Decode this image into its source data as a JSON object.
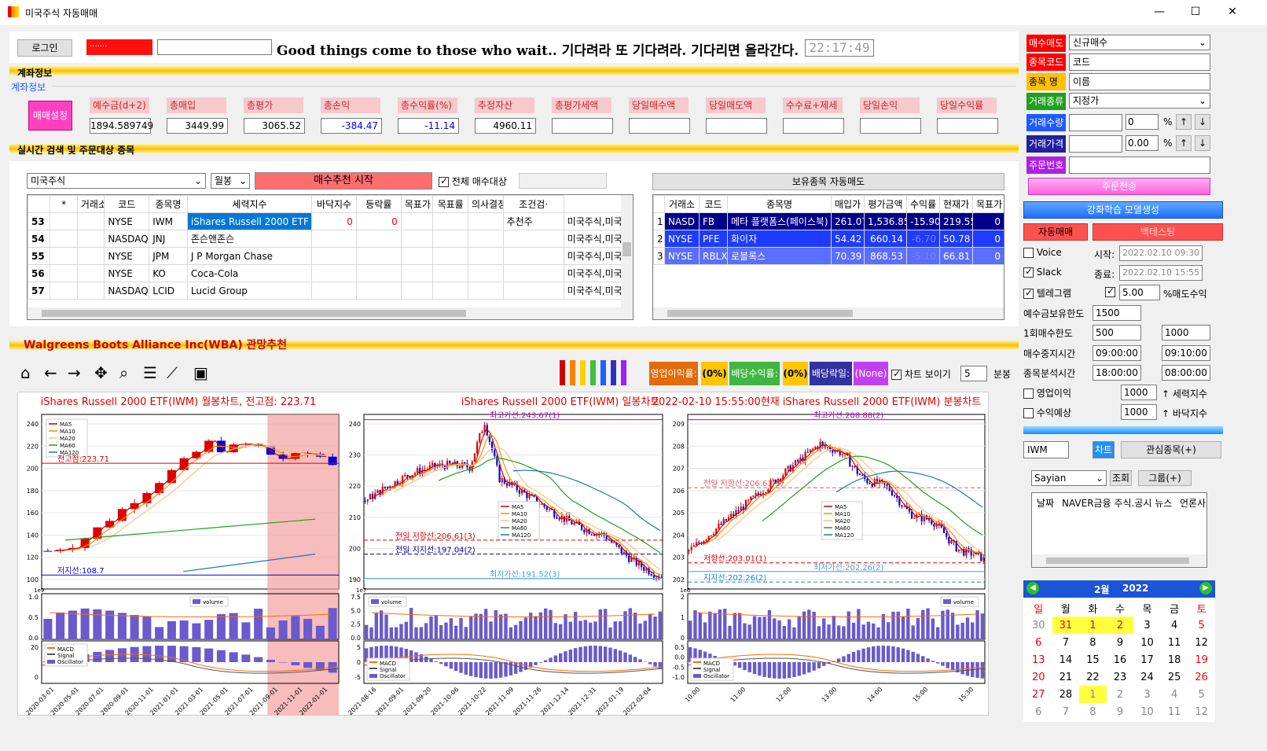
{
  "window": {
    "title": "미국주식 자동매매",
    "min": "—",
    "max": "☐",
    "close": "✕"
  },
  "top": {
    "login_label": "로그인",
    "account_masked": "·······",
    "motto": "Good things come to those who wait..  기다려라 또 기다려라. 기다리면 올라간다.",
    "clock": "22:17:49"
  },
  "account": {
    "bar_label": "계좌정보",
    "group_label": "계좌정보",
    "set_button": "매매설정",
    "fields": [
      {
        "label": "예수금(d+2)",
        "value": "1894.589749",
        "color": "#000000"
      },
      {
        "label": "총매입",
        "value": "3449.99",
        "color": "#000000"
      },
      {
        "label": "총평가",
        "value": "3065.52",
        "color": "#000000"
      },
      {
        "label": "총손익",
        "value": "-384.47",
        "color": "#0000ff"
      },
      {
        "label": "총수익률(%)",
        "value": "-11.14",
        "color": "#0000ff"
      },
      {
        "label": "추정자산",
        "value": "4960.11",
        "color": "#000000"
      },
      {
        "label": "총평가세액",
        "value": "",
        "color": "#000000"
      },
      {
        "label": "당일매수액",
        "value": "",
        "color": "#000000"
      },
      {
        "label": "당일매도액",
        "value": "",
        "color": "#000000"
      },
      {
        "label": "수수료+제세",
        "value": "",
        "color": "#000000"
      },
      {
        "label": "당일손익",
        "value": "",
        "color": "#000000"
      },
      {
        "label": "당일수익률",
        "value": "",
        "color": "#000000"
      }
    ]
  },
  "search": {
    "bar_label": "실시간 검색 및 주문대상 종목",
    "market_select": "미국주식",
    "period_select": "월봉",
    "start_button": "매수추천 시작",
    "all_buy_label": "전체 매수대상",
    "columns": [
      "*",
      "거래소",
      "코드",
      "종목명",
      "세력지수",
      "바닥지수",
      "등락률",
      "목표가",
      "목표률",
      "의사결정번호",
      "조건검·"
    ],
    "rows": [
      {
        "no": "53",
        "star": "",
        "ex": "NYSE",
        "code": "IWM",
        "name": "iShares Russell 2000 ETF",
        "power": "0",
        "floor": "0",
        "chg": "",
        "tp": "",
        "tr": "",
        "dec": "추천주",
        "cond": "미국주식,미국주"
      },
      {
        "no": "54",
        "star": "",
        "ex": "NASDAQ",
        "code": "JNJ",
        "name": "존슨앤존슨",
        "power": "",
        "floor": "",
        "chg": "",
        "tp": "",
        "tr": "",
        "dec": "",
        "cond": "미국주식,미국주"
      },
      {
        "no": "55",
        "star": "",
        "ex": "NYSE",
        "code": "JPM",
        "name": "J P Morgan Chase",
        "power": "",
        "floor": "",
        "chg": "",
        "tp": "",
        "tr": "",
        "dec": "",
        "cond": "미국주식,미국주"
      },
      {
        "no": "56",
        "star": "",
        "ex": "NYSE",
        "code": "KO",
        "name": "Coca-Cola",
        "power": "",
        "floor": "",
        "chg": "",
        "tp": "",
        "tr": "",
        "dec": "",
        "cond": "미국주식,미국주"
      },
      {
        "no": "57",
        "star": "",
        "ex": "NASDAQ",
        "code": "LCID",
        "name": "Lucid Group",
        "power": "",
        "floor": "",
        "chg": "",
        "tp": "",
        "tr": "",
        "dec": "",
        "cond": "미국주식,미국주"
      }
    ]
  },
  "holdings": {
    "header_button": "보유종목 자동매도",
    "columns": [
      "거래소",
      "코드",
      "종목명",
      "매입가",
      "평가금액",
      "수익률",
      "현재가",
      "목표가"
    ],
    "rows": [
      {
        "no": "1",
        "ex": "NASD",
        "code": "FB",
        "name": "메타 플랫폼스(페이스북)",
        "buy": "261.07",
        "eval": "1,536.85",
        "ret": "-15.90",
        "cur": "219.55",
        "tp": "0",
        "bg": "#00008b"
      },
      {
        "no": "2",
        "ex": "NYSE",
        "code": "PFE",
        "name": "화이자",
        "buy": "54.42",
        "eval": "660.14",
        "ret": "-6.70",
        "cur": "50.78",
        "tp": "0",
        "bg": "#1e3cff"
      },
      {
        "no": "3",
        "ex": "NYSE",
        "code": "RBLX",
        "name": "로블록스",
        "buy": "70.39",
        "eval": "868.53",
        "ret": "-5.10",
        "cur": "66.81",
        "tp": "0",
        "bg": "#5a6eff"
      }
    ]
  },
  "chart_area": {
    "title": "Walgreens Boots Alliance Inc(WBA)  관망추천",
    "tags": {
      "op_profit": "영업이익률:",
      "op_val": "(0%)",
      "div_yield": "배당수익률:",
      "div_val": "(0%)",
      "div_date": "배당락일:",
      "div_date_val": "(None)",
      "show_chart": "차트 보이기",
      "minute_val": "5",
      "minute_label": "분봉"
    },
    "colors": [
      "#d00000",
      "#ff8000",
      "#ffd000",
      "#40c040",
      "#2060ff",
      "#3030c0",
      "#a020f0"
    ]
  },
  "chart_data": [
    {
      "type": "candlestick",
      "title": "iShares Russell 2000 ETF(IWM) 월봉차트, 전고점: 223.71",
      "legend": [
        "MA5",
        "MA10",
        "MA20",
        "MA60",
        "MA120"
      ],
      "ylim": [
        100,
        245
      ],
      "yticks": [
        "100",
        "120",
        "140",
        "160",
        "180",
        "200",
        "220",
        "240"
      ],
      "xticks": [
        "2020-03-01",
        "2020-05-01",
        "2020-07-01",
        "2020-09-01",
        "2020-11-01",
        "2021-01-01",
        "2021-03-01",
        "2021-05-01",
        "2021-07-01",
        "2021-09-01",
        "2021-11-01",
        "2022-01-01"
      ],
      "annotations": [
        "전고점:223.71",
        "저지선:108.7"
      ],
      "volume_legend": "volume",
      "volume_yticks": [
        "0.0",
        "0.5",
        "1.0"
      ],
      "volume_scale": "1e9",
      "macd_legend": [
        "MACD",
        "Signal",
        "Oscillator"
      ],
      "macd_yticks": [
        "0",
        "20"
      ]
    },
    {
      "type": "candlestick",
      "title": "iShares Russell 2000 ETF(IWM) 일봉차트",
      "legend": [
        "MA5",
        "MA10",
        "MA20",
        "MA60",
        "MA120"
      ],
      "ylim": [
        188,
        245
      ],
      "yticks": [
        "190",
        "200",
        "210",
        "220",
        "230",
        "240"
      ],
      "xticks": [
        "2021-08-16",
        "2021-09-01",
        "2021-09-20",
        "2021-10-06",
        "2021-10-22",
        "2021-11-09",
        "2021-11-26",
        "2021-12-14",
        "2021-12-31",
        "2022-01-19",
        "2022-02-04"
      ],
      "annotations": [
        "최고가선:243.67(1)",
        "전일 저항선:206.61(3)",
        "전일 지지선:197.04(2)",
        "최저가선:191.52(3)"
      ],
      "volume_legend": "volume",
      "volume_yticks": [
        "0.0",
        "2.5",
        "5.0",
        "7.5"
      ],
      "volume_scale": "1e7",
      "macd_legend": [
        "MACD",
        "Signal",
        "Oscillator"
      ],
      "macd_yticks": [
        "-5",
        "0",
        "5"
      ]
    },
    {
      "type": "candlestick",
      "title": "2022-02-10 15:55:00현재 iShares Russell 2000 ETF(IWM) 분봉차트",
      "legend": [
        "MA5",
        "MA10",
        "MA20",
        "MA60",
        "MA120"
      ],
      "ylim": [
        202,
        209.2
      ],
      "yticks": [
        "202",
        "203",
        "204",
        "205",
        "206",
        "207",
        "208",
        "209"
      ],
      "xticks": [
        "10:00",
        "11:00",
        "12:00",
        "13:00",
        "14:00",
        "15:00",
        "15:30"
      ],
      "annotations": [
        "최고가선:208.88(2)",
        "전일 저항선:206.61(3)",
        "저항선:203.01(1)",
        "지지선:202.26(2)",
        "최저가선:202.26(2)"
      ],
      "volume_legend": "volume",
      "volume_yticks": [
        "0",
        "1",
        "2"
      ],
      "volume_scale": "1e6",
      "macd_legend": [
        "MACD",
        "Signal",
        "Oscillator"
      ],
      "macd_yticks": [
        "-1.0",
        "-0.5",
        "0.0",
        "0.5"
      ]
    }
  ],
  "order": {
    "type_label": "매수매도",
    "type_value": "신규매수",
    "code_label": "종목코드",
    "code_value": "코드",
    "name_label": "종목 명",
    "name_value": "이름",
    "trade_label": "거래종류",
    "trade_value": "지정가",
    "qty_label": "거래수량",
    "qty_spin": "0",
    "qty_unit": "%",
    "price_label": "거래가격",
    "price_spin": "0.00",
    "price_unit": "%",
    "ordno_label": "주문번호",
    "cancel_button": "주문전송",
    "rl_button": "강화학습 모델생성",
    "auto_button": "자동매매",
    "backtest_button": "백테스팅"
  },
  "settings": {
    "voice": "Voice",
    "slack": "Slack",
    "telegram": "텔레그램",
    "start_label": "시작:",
    "start_value": "2022.02.10 09:30",
    "end_label": "종료:",
    "end_value": "2022.02.10 15:55",
    "sell_rate_value": "5.00",
    "sell_rate_label": "%매도수익",
    "deposit_limit_label": "예수금보유한도",
    "deposit_limit_value": "1500",
    "once_limit_label": "1회매수한도",
    "once_limit_value": "500",
    "once_limit_value2": "1000",
    "stop_time_label": "매수중지시간",
    "stop_time_value": "09:00:00",
    "stop_time_value2": "09:10:00",
    "analysis_label": "종목분석시간",
    "analysis_value": "18:00:00",
    "analysis_value2": "08:00:00",
    "op_profit_label": "영업이익",
    "op_profit_value": "1000",
    "op_profit_note": "↑ 세력지수",
    "expected_label": "수익예상",
    "expected_value": "1000",
    "expected_note": "↑ 바닥지수",
    "ticker_value": "IWM",
    "chart_button": "차트",
    "watch_button": "관심종목(+)",
    "user_select": "Sayian",
    "lookup_button": "조회",
    "group_button": "그룹(+)",
    "news_cols": [
      "날짜",
      "NAVER금융 주식.공시 뉴스",
      "언론사"
    ]
  },
  "calendar": {
    "month_label": "2월",
    "year_label": "2022",
    "weekdays": [
      "일",
      "월",
      "화",
      "수",
      "목",
      "금",
      "토"
    ],
    "weeks": [
      [
        "30",
        "31",
        "1",
        "2",
        "3",
        "4",
        "5"
      ],
      [
        "6",
        "7",
        "8",
        "9",
        "10",
        "11",
        "12"
      ],
      [
        "13",
        "14",
        "15",
        "16",
        "17",
        "18",
        "19"
      ],
      [
        "20",
        "21",
        "22",
        "23",
        "24",
        "25",
        "26"
      ],
      [
        "27",
        "28",
        "1",
        "2",
        "3",
        "4",
        "5"
      ],
      [
        "6",
        "7",
        "8",
        "9",
        "10",
        "11",
        "12"
      ]
    ]
  }
}
